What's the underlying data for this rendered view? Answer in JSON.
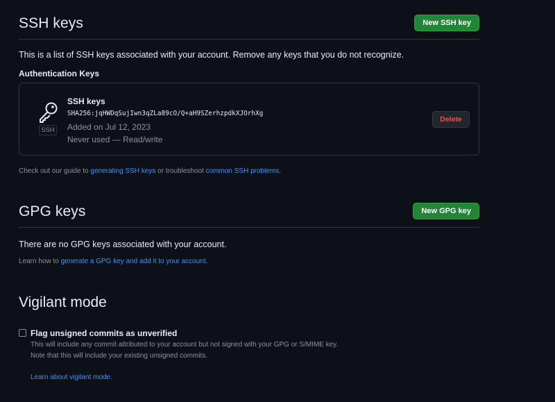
{
  "ssh": {
    "title": "SSH keys",
    "new_button": "New SSH key",
    "intro": "This is a list of SSH keys associated with your account. Remove any keys that you do not recognize.",
    "subheading": "Authentication Keys",
    "keys": [
      {
        "badge": "SSH",
        "title": "SSH keys",
        "fingerprint": "SHA256:jqHWDqSujIwn3qZLa89cO/Q+aH9SZerhzpdkXJOrhXg",
        "added": "Added on Jul 12, 2023",
        "usage": "Never used — Read/write",
        "delete_label": "Delete",
        "icon": "key-icon"
      }
    ],
    "guide": {
      "prefix": "Check out our guide to ",
      "link1": "generating SSH keys",
      "middle": " or troubleshoot ",
      "link2": "common SSH problems",
      "suffix": "."
    }
  },
  "gpg": {
    "title": "GPG keys",
    "new_button": "New GPG key",
    "empty": "There are no GPG keys associated with your account.",
    "learn": {
      "prefix": "Learn how to ",
      "link": "generate a GPG key and add it to your account",
      "suffix": "."
    }
  },
  "vigilant": {
    "title": "Vigilant mode",
    "checkbox_label": "Flag unsigned commits as unverified",
    "checked": false,
    "desc1": "This will include any commit attributed to your account but not signed with your GPG or S/MIME key.",
    "desc2": "Note that this will include your existing unsigned commits.",
    "learn_link": "Learn about vigilant mode."
  },
  "colors": {
    "background": "#0d1117",
    "border": "#30363d",
    "primary_button": "#238636",
    "danger": "#f85149",
    "link": "#4493f8",
    "muted": "#8b949e"
  }
}
